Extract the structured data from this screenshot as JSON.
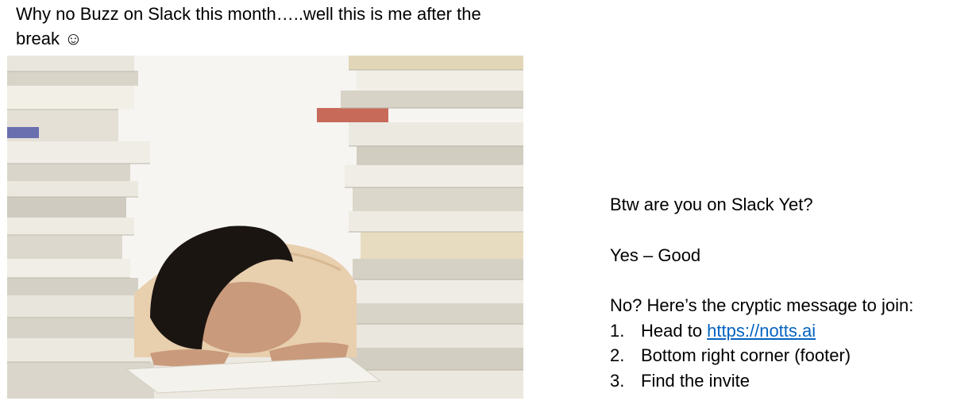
{
  "slide": {
    "title": "Why no Buzz on Slack this month…..well this is me after the break ☺",
    "photo": {
      "description_icon": "sleeping-person-between-paper-stacks-photo"
    },
    "side": {
      "question": "Btw are you on Slack Yet?",
      "yes_line": "Yes – Good",
      "no_line": "No? Here’s the cryptic message to join:",
      "steps": [
        {
          "number": "1.",
          "prefix": "Head to ",
          "link_text": "https://notts.ai"
        },
        {
          "number": "2.",
          "text": "Bottom right corner (footer)"
        },
        {
          "number": "3.",
          "text": "Find the invite"
        }
      ]
    },
    "colors": {
      "link": "#0563c1",
      "text": "#000000",
      "background": "#ffffff"
    }
  }
}
